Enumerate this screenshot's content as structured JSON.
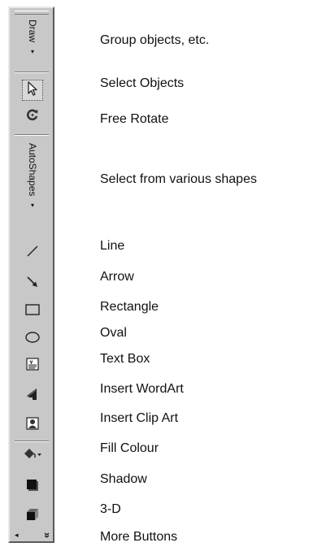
{
  "toolbar": {
    "draw_menu": "Draw",
    "autoshapes_menu": "AutoShapes",
    "dropdown_caret": "▾",
    "more_caret": "»"
  },
  "labels": {
    "group_objects": "Group objects, etc.",
    "select_objects": "Select Objects",
    "free_rotate": "Free Rotate",
    "select_shapes": "Select from various shapes",
    "line": "Line",
    "arrow": "Arrow",
    "rectangle": "Rectangle",
    "oval": "Oval",
    "text_box": "Text Box",
    "insert_wordart": "Insert WordArt",
    "insert_clip_art": "Insert Clip Art",
    "fill_colour": "Fill Colour",
    "shadow": "Shadow",
    "three_d": "3-D",
    "more_buttons": "More Buttons"
  },
  "icons": {
    "select_objects": "cursor-arrow-icon",
    "free_rotate": "rotate-icon",
    "line": "line-icon",
    "arrow": "arrow-icon",
    "rectangle": "rectangle-icon",
    "oval": "oval-icon",
    "text_box": "text-box-icon",
    "insert_wordart": "wordart-icon",
    "insert_clip_art": "clip-art-icon",
    "fill_colour": "paint-bucket-icon",
    "shadow": "shadow-icon",
    "three_d": "3d-cube-icon"
  }
}
